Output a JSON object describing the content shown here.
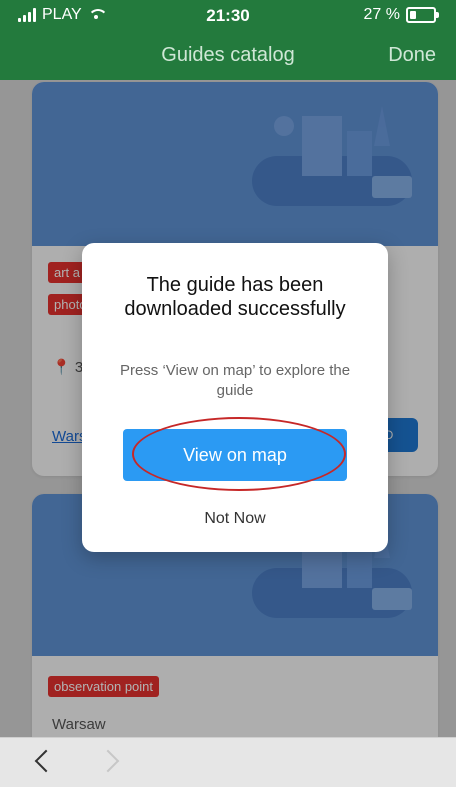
{
  "status_bar": {
    "carrier": "PLAY",
    "time": "21:30",
    "battery": "27 %"
  },
  "header": {
    "title": "Guides catalog",
    "done_label": "Done"
  },
  "cards": [
    {
      "tags": [
        "art a",
        "photo"
      ],
      "meta": "3",
      "link": "Wars",
      "download_label": "D"
    },
    {
      "tags": [
        "observation point"
      ],
      "meta": "Warsaw"
    }
  ],
  "dialog": {
    "title": "The guide has been downloaded successfully",
    "message": "Press ‘View on map’ to explore the guide",
    "primary": "View on map",
    "secondary": "Not Now"
  },
  "bottom_nav": {
    "back": "back",
    "forward": "forward"
  },
  "colors": {
    "header_bg": "#237a3d",
    "primary_button": "#2b9af3",
    "tag_red": "#e5322e",
    "highlight_red": "#c62828"
  }
}
